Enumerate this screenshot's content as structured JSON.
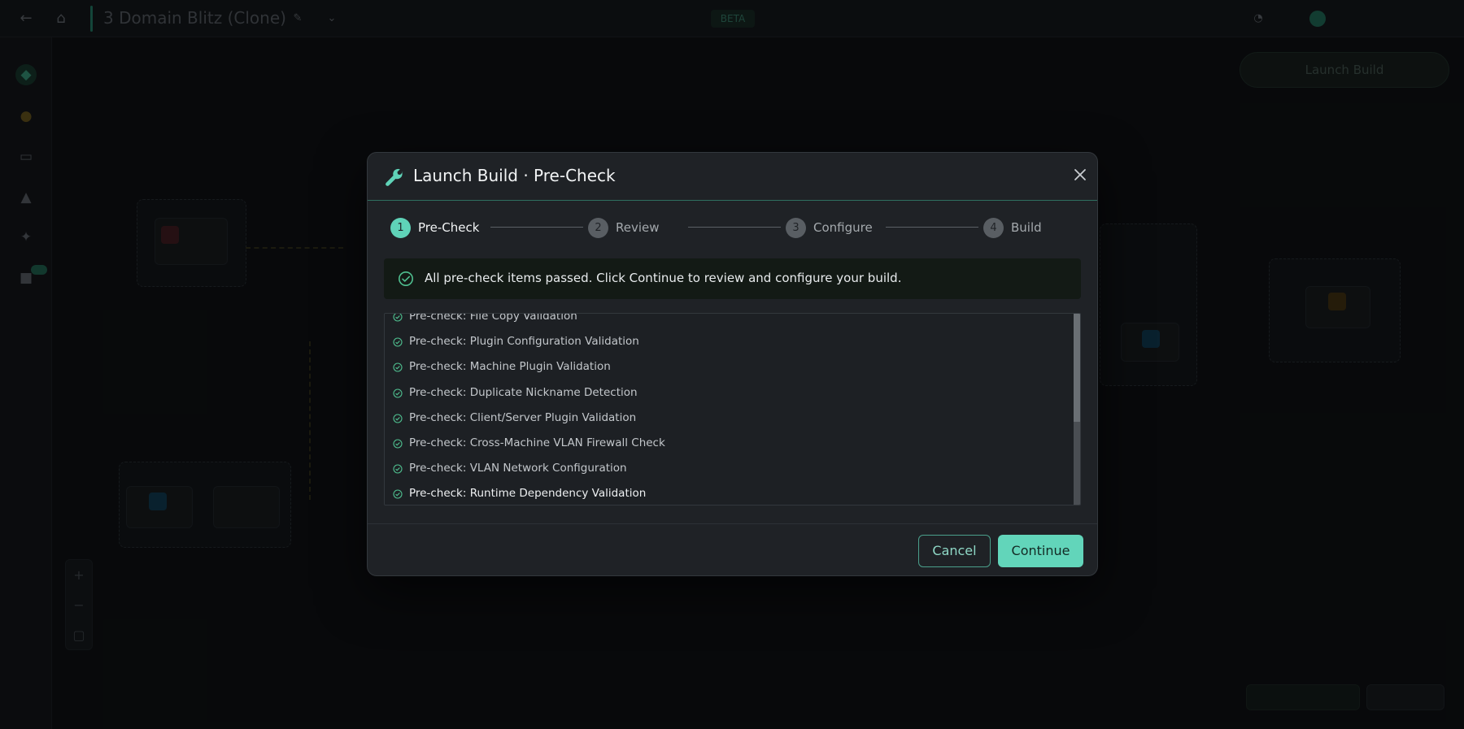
{
  "background": {
    "project_title": "3 Domain Blitz (Clone)",
    "beta_badge": "BETA",
    "launch_button": "Launch Build"
  },
  "modal": {
    "title": "Launch Build · Pre-Check",
    "steps": [
      {
        "num": "1",
        "label": "Pre-Check"
      },
      {
        "num": "2",
        "label": "Review"
      },
      {
        "num": "3",
        "label": "Configure"
      },
      {
        "num": "4",
        "label": "Build"
      }
    ],
    "alert_text": "All pre-check items passed. Click Continue to review and configure your build.",
    "checks": [
      "Pre-check: File Copy Validation",
      "Pre-check: Plugin Configuration Validation",
      "Pre-check: Machine Plugin Validation",
      "Pre-check: Duplicate Nickname Detection",
      "Pre-check: Client/Server Plugin Validation",
      "Pre-check: Cross-Machine VLAN Firewall Check",
      "Pre-check: VLAN Network Configuration",
      "Pre-check: Runtime Dependency Validation"
    ],
    "cancel_label": "Cancel",
    "continue_label": "Continue"
  },
  "colors": {
    "accent": "#62d5ba",
    "modal_bg": "#1f2226",
    "alert_bg": "#131a15",
    "success": "#4fbf8f"
  }
}
